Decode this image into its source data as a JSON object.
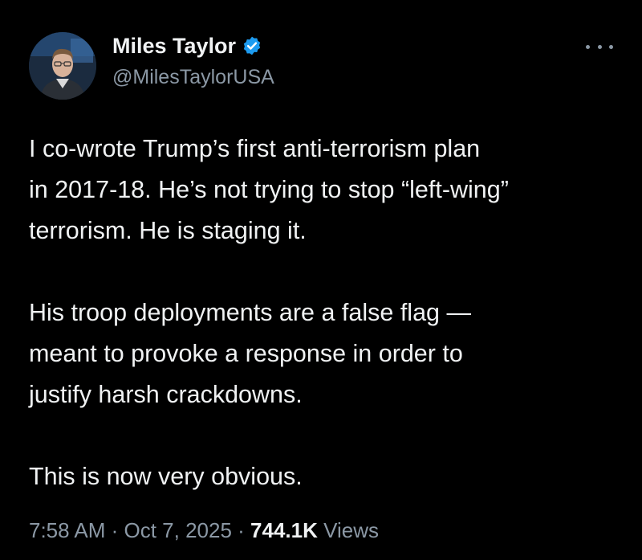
{
  "author": {
    "display_name": "Miles Taylor",
    "handle": "@MilesTaylorUSA",
    "verified": true,
    "verified_color": "#1d9bf0"
  },
  "tweet": {
    "paragraphs": [
      {
        "lines": [
          "I co-wrote Trump’s first anti-terrorism plan",
          "in 2017-18. He’s not trying to stop “left-wing”",
          "terrorism. He is staging it."
        ]
      },
      {
        "lines": [
          "His troop deployments are a false flag —",
          "meant to provoke a response in order to",
          "justify harsh crackdowns."
        ]
      },
      {
        "lines": [
          "This is now very obvious."
        ]
      }
    ]
  },
  "meta": {
    "time": "7:58 AM",
    "separator": " · ",
    "date": "Oct 7, 2025",
    "views_count": "744.1K",
    "views_label": "Views"
  },
  "icons": {
    "more": "more-horizontal-icon",
    "verified": "verified-badge-icon"
  },
  "colors": {
    "background": "#000000",
    "text": "#e7e9ea",
    "secondary": "#8b98a5"
  }
}
